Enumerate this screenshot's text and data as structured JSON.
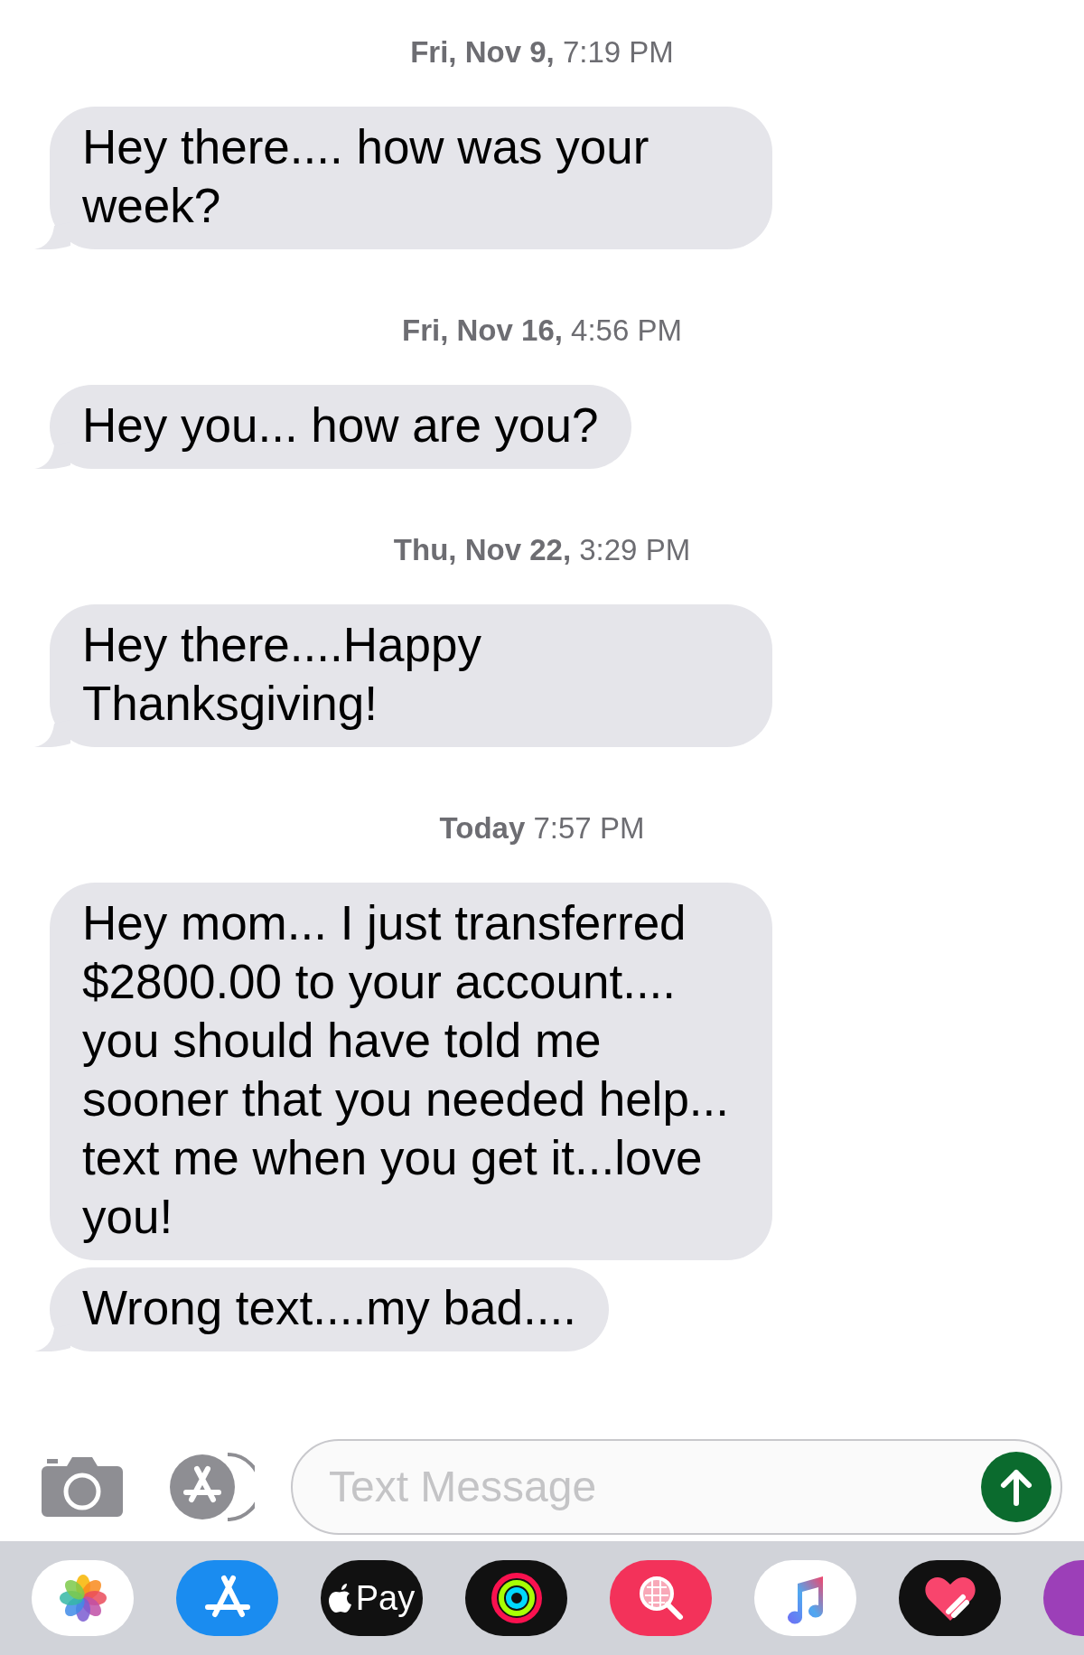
{
  "conversation": [
    {
      "kind": "timestamp",
      "text": "**Fri, Nov 9,** 7:19 PM"
    },
    {
      "kind": "message",
      "text": "Hey there.... how was your week?",
      "tail": true
    },
    {
      "kind": "timestamp",
      "text": "**Fri, Nov 16,** 4:56 PM"
    },
    {
      "kind": "message",
      "text": "Hey you... how are you?",
      "tail": true
    },
    {
      "kind": "timestamp",
      "text": "**Thu, Nov 22,** 3:29 PM"
    },
    {
      "kind": "message",
      "text": "Hey there....Happy Thanksgiving!",
      "tail": true
    },
    {
      "kind": "timestamp",
      "text": "**Today** 7:57 PM"
    },
    {
      "kind": "message",
      "text": "Hey mom... I just transferred $2800.00 to your account.... you should have told me sooner that you needed help... text me when you get it...love you!",
      "tail": false
    },
    {
      "kind": "message",
      "text": "Wrong text....my bad....",
      "tail": true
    }
  ],
  "composer": {
    "placeholder": "Text Message"
  },
  "app_drawer": [
    {
      "kind": "photos"
    },
    {
      "kind": "appstore"
    },
    {
      "kind": "pay",
      "label": "Pay"
    },
    {
      "kind": "activity"
    },
    {
      "kind": "image-search"
    },
    {
      "kind": "music"
    },
    {
      "kind": "heart"
    },
    {
      "kind": "partial"
    }
  ]
}
